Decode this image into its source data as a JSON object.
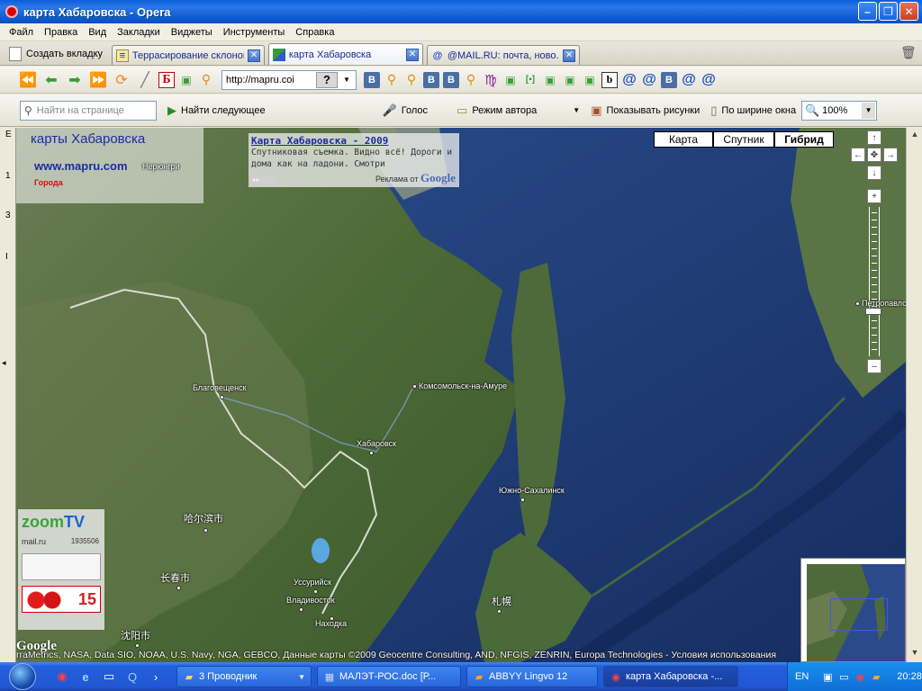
{
  "window": {
    "title": "карта Хабаровска - Opera"
  },
  "menu": [
    "Файл",
    "Правка",
    "Вид",
    "Закладки",
    "Виджеты",
    "Инструменты",
    "Справка"
  ],
  "tabs": {
    "new_tab_label": "Создать вкладку",
    "items": [
      {
        "label": "Террасирование склонов",
        "active": false
      },
      {
        "label": "карта Хабаровска",
        "active": true
      },
      {
        "label": "@MAIL.RU: почта, ново...",
        "active": false
      }
    ]
  },
  "address": {
    "value": "http://mapru.coi",
    "help": "?"
  },
  "bookmarks": {
    "b_letter": "b",
    "be_letter": "Б",
    "vk_letter": "В"
  },
  "findbar": {
    "placeholder": "Найти на странице",
    "find_next": "Найти следующее",
    "voice": "Голос",
    "author_mode": "Режим автора",
    "show_images": "Показывать рисунки",
    "fit_width": "По ширине окна",
    "zoom": "100%"
  },
  "left_strip": [
    "E",
    "1",
    "3",
    "I"
  ],
  "map": {
    "site_title": "карты Хабаровска",
    "site_link": "www.mapru.com",
    "cities_link": "Города",
    "ad": {
      "title": "Карта Хабаровска - 2009",
      "text": "Спутниковая съемка. Видно всё! Дороги и дома как на ладони. Смотри",
      "footer": "Реклама от",
      "footer_brand": "Google"
    },
    "map_types": [
      {
        "label": "Карта",
        "active": false
      },
      {
        "label": "Спутник",
        "active": false
      },
      {
        "label": "Гибрид",
        "active": true
      }
    ],
    "cities": {
      "neryungri": "Нерюнгри",
      "blagoveshchensk": "Благовещенск",
      "komsomolsk": "Комсомольск-на-Амуре",
      "khabarovsk": "Хабаровск",
      "yuzhno": "Южно-Сахалинск",
      "harbin": "哈尔滨市",
      "changchun": "长春市",
      "ussuriysk": "Уссурийск",
      "vladivostok": "Владивосток",
      "nakhodka": "Находка",
      "sapporo": "札幌",
      "shenyang": "沈阳市",
      "petropavlovsk": "Петропавло"
    },
    "widget": {
      "logo_a": "zoom",
      "logo_b": "TV",
      "mail": "mail.ru",
      "counter": "1935506",
      "number": "15"
    },
    "google_logo": "Google",
    "copyright": "rraMetrics, NASA, Data SIO, NOAA, U.S. Navy, NGA, GEBCO, Данные карты ©2009 Geocentre Consulting, AND, NFGIS, ZENRIN, Europa Technologies - Условия использования"
  },
  "taskbar": {
    "tasks": [
      {
        "label": "3 Проводник",
        "active": false,
        "caret": true
      },
      {
        "label": "МАЛЭТ-РОС.doc [Р...",
        "active": false,
        "caret": false
      },
      {
        "label": "ABBYY Lingvo 12",
        "active": false,
        "caret": false
      },
      {
        "label": "карта Хабаровска -...",
        "active": true,
        "caret": false
      }
    ],
    "lang": "EN",
    "clock": "20:28"
  },
  "colors": {
    "titlebar": "#0a5fd8",
    "sea": "#1f3d78",
    "land": "#4f6e3a",
    "link": "#1b2ea0",
    "taskbar": "#245edb"
  }
}
